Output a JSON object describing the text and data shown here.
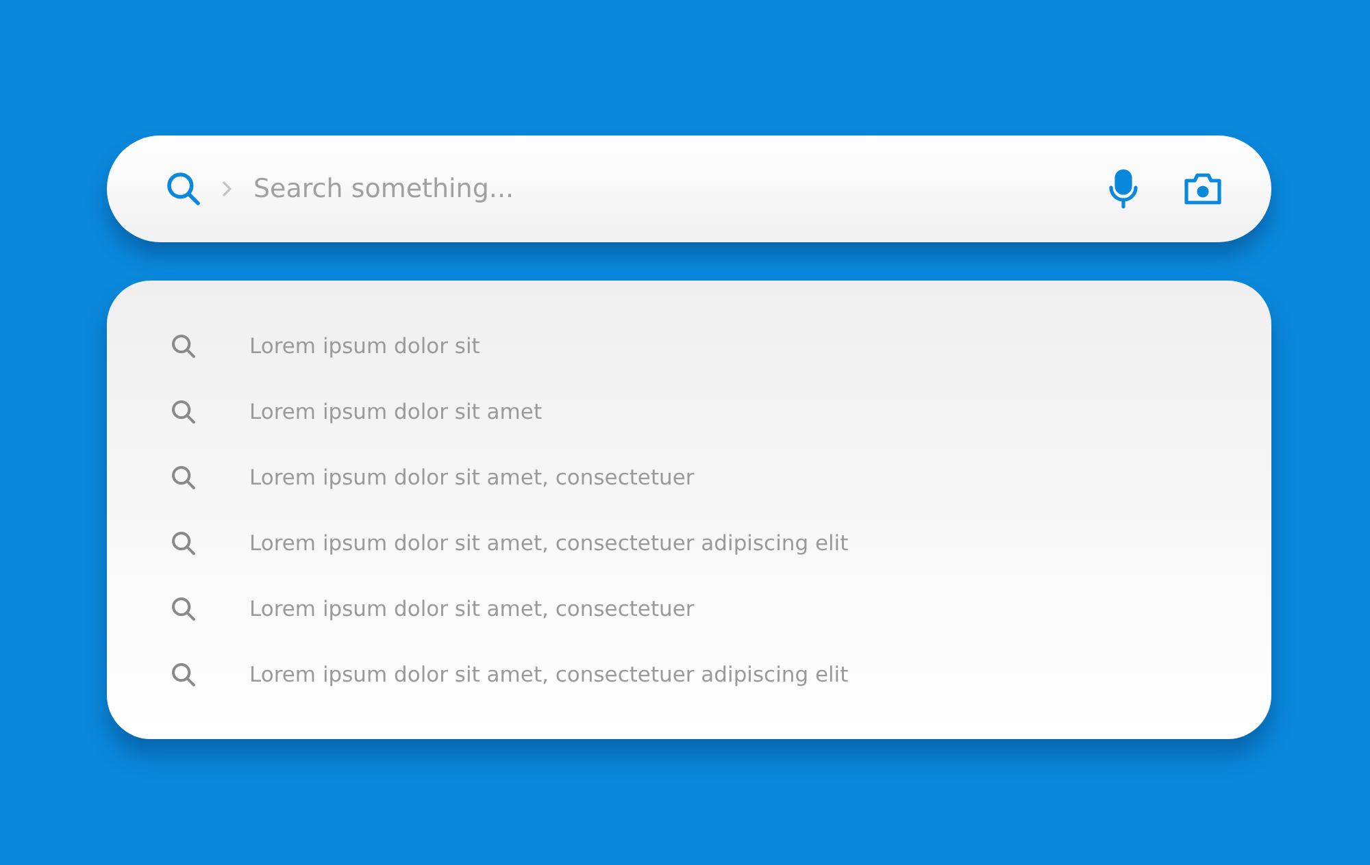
{
  "search": {
    "placeholder": "Search something..."
  },
  "suggestions": [
    {
      "text": "Lorem ipsum dolor sit"
    },
    {
      "text": "Lorem ipsum dolor sit amet"
    },
    {
      "text": "Lorem ipsum dolor sit amet, consectetuer"
    },
    {
      "text": "Lorem ipsum dolor sit amet, consectetuer adipiscing elit"
    },
    {
      "text": "Lorem ipsum dolor sit amet, consectetuer"
    },
    {
      "text": "Lorem ipsum dolor sit amet, consectetuer adipiscing elit"
    }
  ]
}
